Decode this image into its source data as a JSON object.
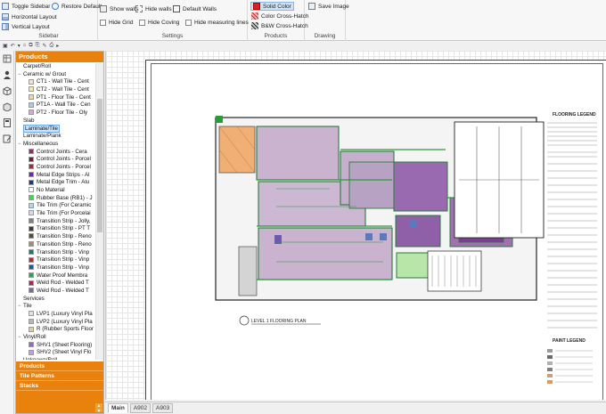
{
  "ribbon": {
    "sidebar": {
      "title": "Sidebar",
      "items": [
        "Toggle Sidebar",
        "Restore Default",
        "Horizontal Layout",
        "Vertical Layout"
      ]
    },
    "settings": {
      "title": "Settings",
      "show_walls": "Show walls",
      "hide_walls": "Hide walls",
      "default_walls": "Default Walls",
      "hide_grid": "Hide Grid",
      "hide_coving": "Hide Coving",
      "hide_measuring": "Hide measuring lines"
    },
    "products": {
      "title": "Products",
      "solid": "Solid Color",
      "cross": "Color Cross-Hatch",
      "bw": "B&W Cross-Hatch"
    },
    "drawing": {
      "title": "Drawing",
      "save": "Save Image"
    }
  },
  "panel": {
    "title": "Products",
    "tree": [
      {
        "label": "Carpet/Roll",
        "level": 1,
        "exp": ""
      },
      {
        "label": "Ceramic w/ Grout",
        "level": 0,
        "exp": "−"
      },
      {
        "label": "CT1 - Wall Tile - Cent",
        "level": 2,
        "color": "#f4e3c6"
      },
      {
        "label": "CT2 - Wall Tile - Cent",
        "level": 2,
        "color": "#f6eaa5"
      },
      {
        "label": "PT1 - Floor Tile - Cent",
        "level": 2,
        "color": "#f7d2a8"
      },
      {
        "label": "PT1A - Wall Tile - Cen",
        "level": 2,
        "color": "#a9cbe3"
      },
      {
        "label": "PT2 - Floor Tile - Oly",
        "level": 2,
        "color": "#d7a7d7"
      },
      {
        "label": "Slab",
        "level": 1,
        "exp": ""
      },
      {
        "label": "Laminate/Tile",
        "level": 1,
        "exp": "",
        "hl": true
      },
      {
        "label": "Laminate/Plank",
        "level": 1,
        "exp": ""
      },
      {
        "label": "Miscellaneous",
        "level": 0,
        "exp": "−"
      },
      {
        "label": "Control Joints - Cera",
        "level": 2,
        "color": "#8b2f6b"
      },
      {
        "label": "Control Joints - Porcel",
        "level": 2,
        "color": "#6b1f3f"
      },
      {
        "label": "Control Joints - Porcel",
        "level": 2,
        "color": "#a82a3a"
      },
      {
        "label": "Metal Edge Strips - Al",
        "level": 2,
        "color": "#7a1fa8"
      },
      {
        "label": "Metal Edge Trim - Alu",
        "level": 2,
        "color": "#203a6b"
      },
      {
        "label": "No Material",
        "level": 2,
        "color": "#ffffff"
      },
      {
        "label": "Rubber Base (RB1) - J",
        "level": 2,
        "color": "#2de04a"
      },
      {
        "label": "Tile Trim (For Ceramic",
        "level": 2,
        "color": "#a8d8f0"
      },
      {
        "label": "Tile Trim (For Porcelai",
        "level": 2,
        "color": "#e3d3f0"
      },
      {
        "label": "Transition Strip - Jolly,",
        "level": 2,
        "color": "#808080"
      },
      {
        "label": "Transition Strip - PT T",
        "level": 2,
        "color": "#3a3a3a"
      },
      {
        "label": "Transition Strip - Reno",
        "level": 2,
        "color": "#5a4a3a"
      },
      {
        "label": "Transition Strip - Reno",
        "level": 2,
        "color": "#a09070"
      },
      {
        "label": "Transition Strip - Vinp",
        "level": 2,
        "color": "#207a5a"
      },
      {
        "label": "Transition Strip - Vinp",
        "level": 2,
        "color": "#c0243a"
      },
      {
        "label": "Transition Strip - Vinp",
        "level": 2,
        "color": "#1a5aa8"
      },
      {
        "label": "Water Proof Membra",
        "level": 2,
        "color": "#2aa85a"
      },
      {
        "label": "Weld Rod - Welded T",
        "level": 2,
        "color": "#b02050"
      },
      {
        "label": "Weld Rod - Welded T",
        "level": 2,
        "color": "#7a6a9a"
      },
      {
        "label": "Services",
        "level": 1,
        "exp": ""
      },
      {
        "label": "Tile",
        "level": 0,
        "exp": "−"
      },
      {
        "label": "LVP1 (Luxury Vinyl Pla",
        "level": 2,
        "color": "#e0e0e0"
      },
      {
        "label": "LVP2 (Luxury Vinyl Pla",
        "level": 2,
        "color": "#b8b8b8"
      },
      {
        "label": "R (Rubber Sports Floor",
        "level": 2,
        "color": "#d8d0a0"
      },
      {
        "label": "Vinyl/Roll",
        "level": 0,
        "exp": "−"
      },
      {
        "label": "SHV1 (Sheet Flooring)",
        "level": 2,
        "color": "#9a6ab8"
      },
      {
        "label": "SHV2 (Sheet Vinyl Flo",
        "level": 2,
        "color": "#c0a0d8"
      },
      {
        "label": "Unknown/Roll",
        "level": 1,
        "exp": ""
      }
    ],
    "footer": [
      "Products",
      "Tile Patterns",
      "Stacks"
    ]
  },
  "plan": {
    "title": "LEVEL 1 FLOORING PLAN",
    "legend1": "FLOORING LEGEND",
    "legend2": "PAINT LEGEND"
  },
  "tabs": [
    "Main",
    "A902",
    "A903"
  ]
}
